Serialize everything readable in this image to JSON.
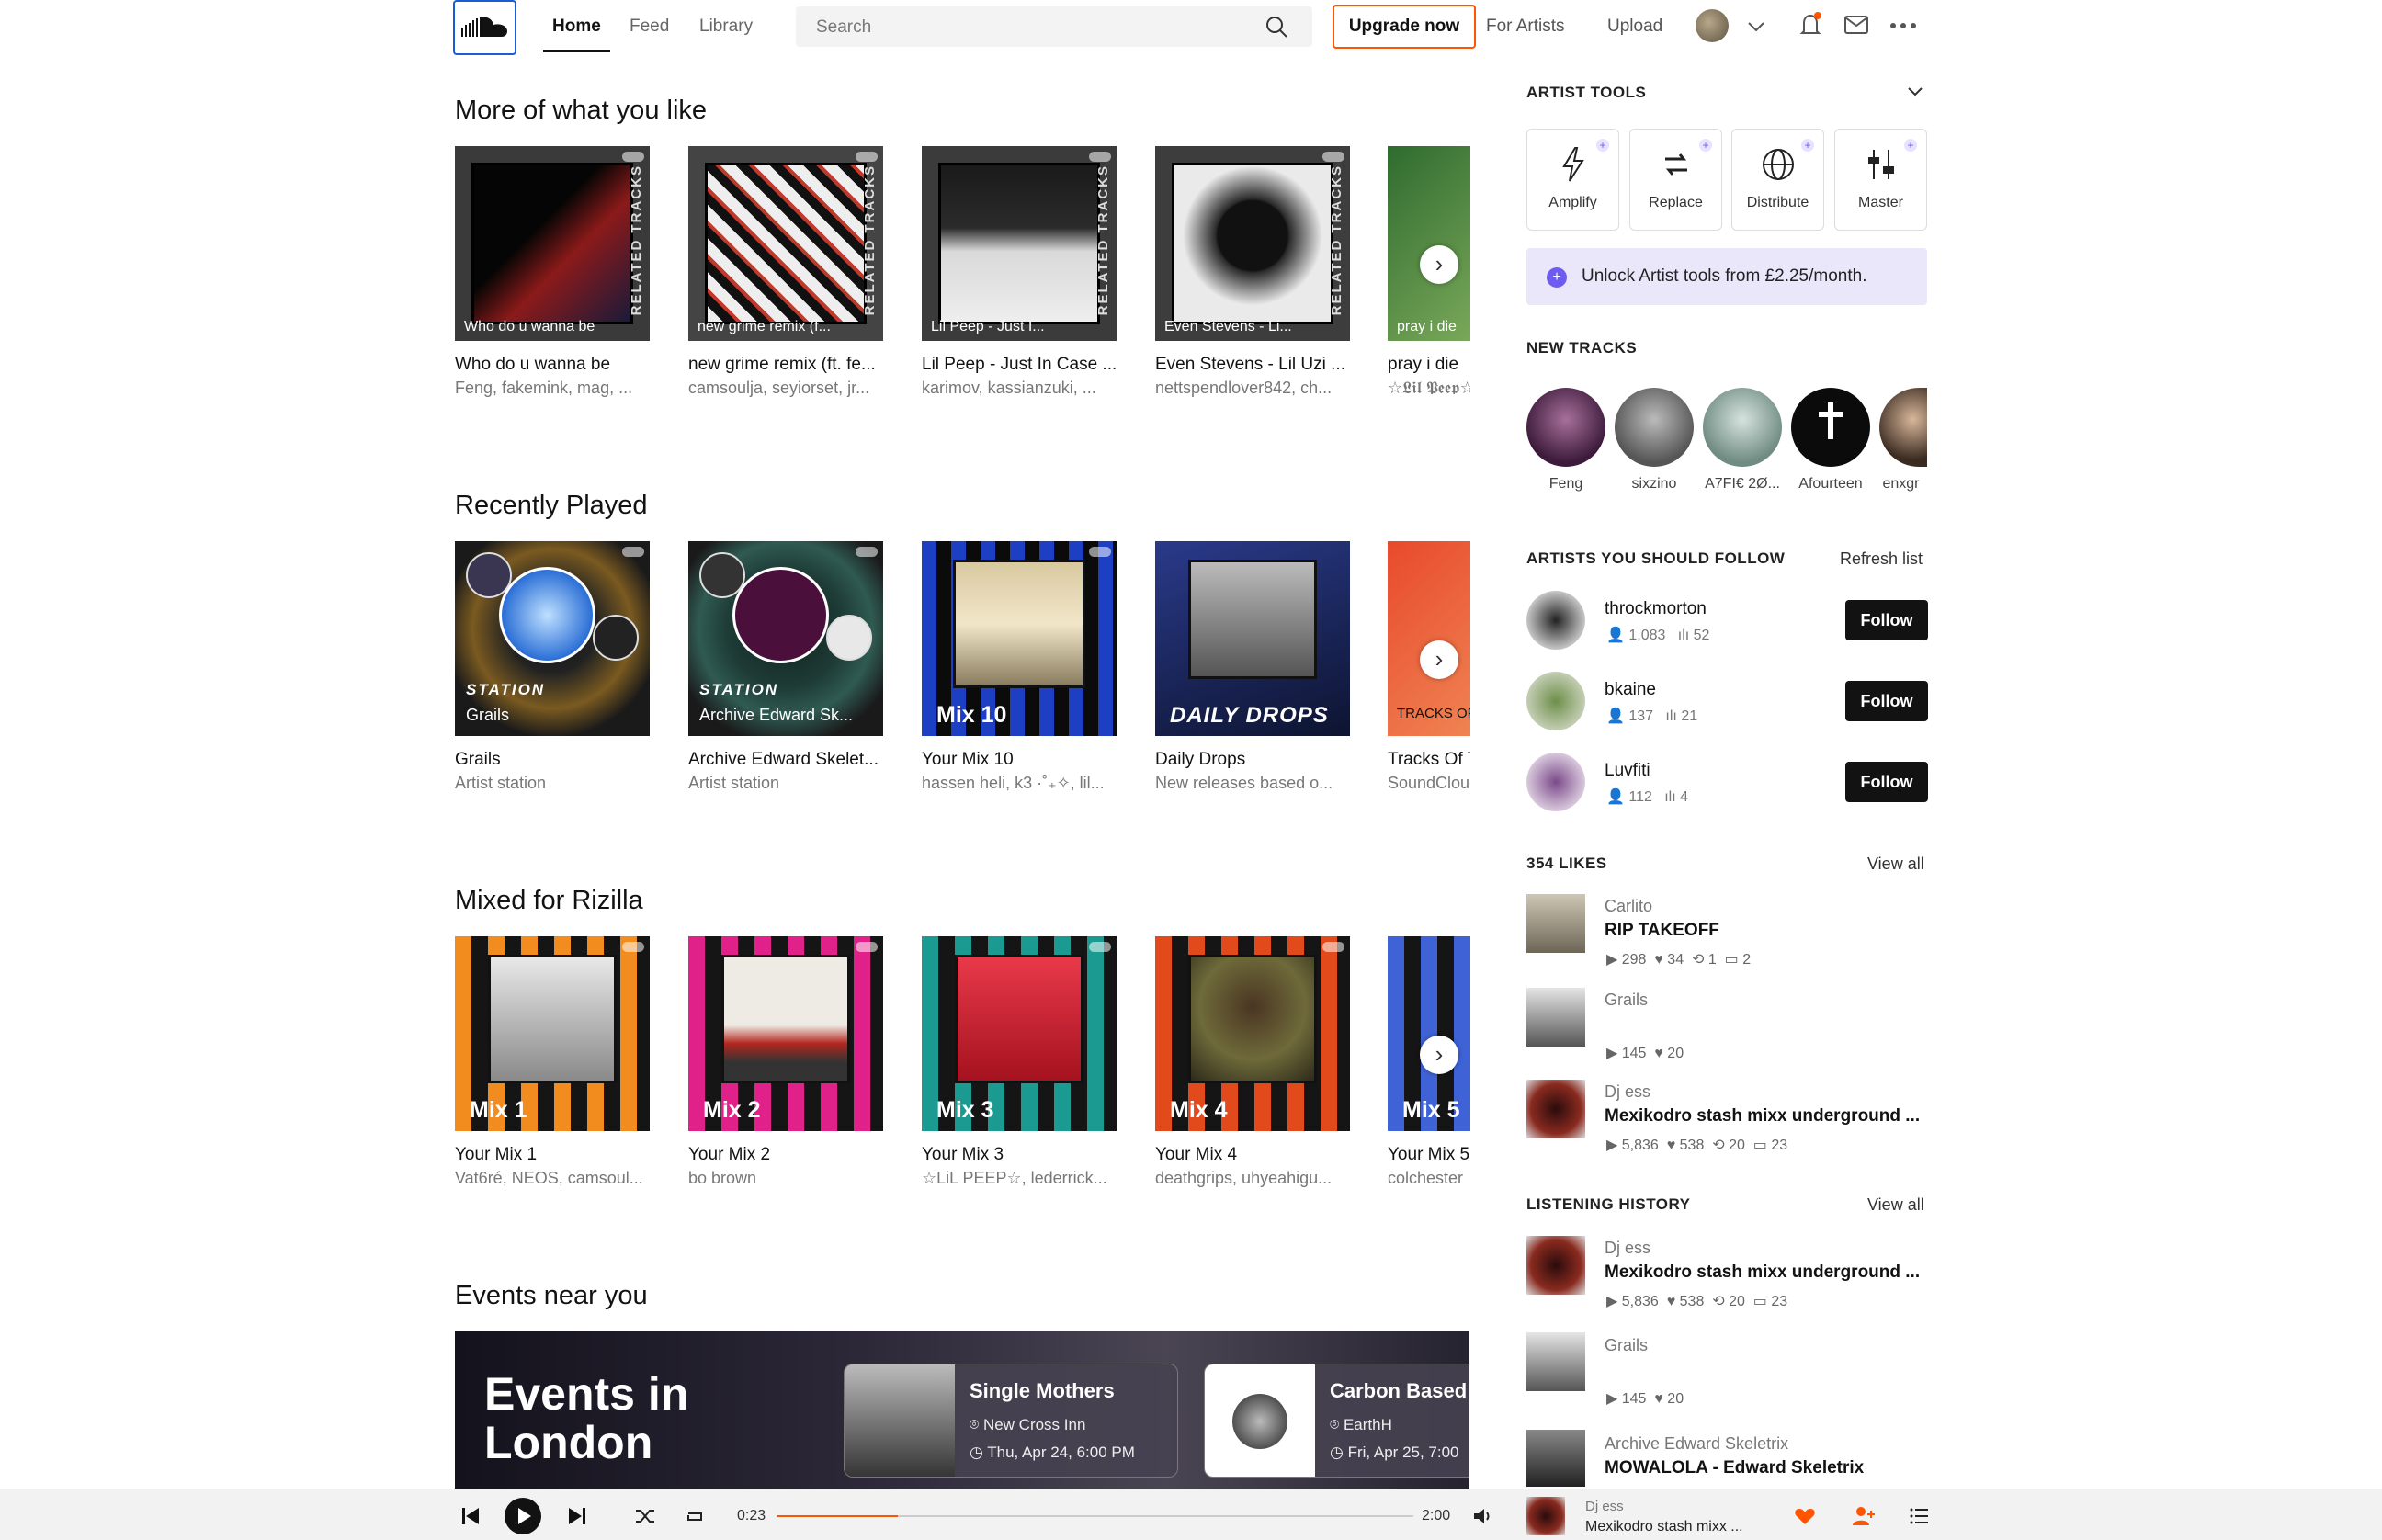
{
  "nav": {
    "tabs": [
      "Home",
      "Feed",
      "Library"
    ],
    "search_placeholder": "Search",
    "upgrade": "Upgrade now",
    "for_artists": "For Artists",
    "upload": "Upload"
  },
  "sections": {
    "more_like": "More of what you like",
    "recently_played": "Recently Played",
    "mixed_for": "Mixed for Rizilla",
    "events": "Events near you"
  },
  "more_like": [
    {
      "overlay": "Who do u wanna be",
      "title": "Who do u wanna be",
      "subtitle": "Feng, fakemink, mag, ...",
      "badge": "RELATED TRACKS"
    },
    {
      "overlay": "new grime remix (f...",
      "title": "new grime remix (ft. fe...",
      "subtitle": "camsoulja, seyiorset, jr...",
      "badge": "RELATED TRACKS"
    },
    {
      "overlay": "Lil Peep - Just I...",
      "title": "Lil Peep - Just In Case ...",
      "subtitle": "karimov, kassianzuki, ...",
      "badge": "RELATED TRACKS"
    },
    {
      "overlay": "Even Stevens - Li...",
      "title": "Even Stevens - Lil Uzi ...",
      "subtitle": "nettspendlover842, ch...",
      "badge": "RELATED TRACKS"
    },
    {
      "overlay": "pray i die",
      "title": "pray i die",
      "subtitle": "☆𝕷𝖎𝖑 𝕻𝖊𝖊𝖕☆"
    }
  ],
  "recently_played": [
    {
      "station_label": "STATION",
      "overlay": "Grails",
      "title": "Grails",
      "subtitle": "Artist station"
    },
    {
      "station_label": "STATION",
      "overlay": "Archive Edward Sk...",
      "title": "Archive Edward Skelet...",
      "subtitle": "Artist station"
    },
    {
      "overlay": "Mix 10",
      "title": "Your Mix 10",
      "subtitle": "hassen heli, k3 ·˚₊✧, lil..."
    },
    {
      "overlay": "DAILY DROPS",
      "title": "Daily Drops",
      "subtitle": "New releases based o..."
    },
    {
      "overlay": "TRACKS OF",
      "title": "Tracks Of The Week",
      "subtitle": "SoundCloud"
    }
  ],
  "mixed_for": [
    {
      "overlay": "Mix 1",
      "title": "Your Mix 1",
      "subtitle": "Vat6ré, NEOS, camsoul..."
    },
    {
      "overlay": "Mix 2",
      "title": "Your Mix 2",
      "subtitle": "bo brown"
    },
    {
      "overlay": "Mix 3",
      "title": "Your Mix 3",
      "subtitle": "☆LiL PEEP☆, lederrick..."
    },
    {
      "overlay": "Mix 4",
      "title": "Your Mix 4",
      "subtitle": "deathgrips, uhyeahigu..."
    },
    {
      "overlay": "Mix 5",
      "title": "Your Mix 5",
      "subtitle": "colchester"
    }
  ],
  "events": {
    "heading_line1": "Events in",
    "heading_line2": "London",
    "cards": [
      {
        "name": "Single Mothers",
        "venue": "New Cross Inn",
        "date": "Thu, Apr 24, 6:00 PM"
      },
      {
        "name": "Carbon Based",
        "venue": "EarthH",
        "date": "Fri, Apr 25, 7:00"
      }
    ]
  },
  "sidebar": {
    "artist_tools": {
      "title": "ARTIST TOOLS",
      "tools": [
        "Amplify",
        "Replace",
        "Distribute",
        "Master"
      ],
      "unlock": "Unlock Artist tools from £2.25/month."
    },
    "new_tracks": {
      "title": "NEW TRACKS",
      "artists": [
        "Feng",
        "sixzino",
        "A7FI€ 2Ø...",
        "Afourteen",
        "enxgr"
      ]
    },
    "follow": {
      "title": "ARTISTS YOU SHOULD FOLLOW",
      "refresh": "Refresh list",
      "button": "Follow",
      "artists": [
        {
          "name": "throckmorton",
          "followers": "1,083",
          "tracks": "52"
        },
        {
          "name": "bkaine",
          "followers": "137",
          "tracks": "21"
        },
        {
          "name": "Luvfiti",
          "followers": "112",
          "tracks": "4"
        }
      ]
    },
    "likes": {
      "title": "354 LIKES",
      "view_all": "View all",
      "items": [
        {
          "artist": "Carlito",
          "title": "RIP TAKEOFF",
          "plays": "298",
          "likes": "34",
          "reposts": "1",
          "comments": "2"
        },
        {
          "artist": "Grails",
          "title": "",
          "plays": "145",
          "likes": "20"
        },
        {
          "artist": "Dj ess",
          "title": "Mexikodro stash mixx underground ...",
          "plays": "5,836",
          "likes": "538",
          "reposts": "20",
          "comments": "23"
        }
      ]
    },
    "history": {
      "title": "LISTENING HISTORY",
      "view_all": "View all",
      "items": [
        {
          "artist": "Dj ess",
          "title": "Mexikodro stash mixx underground ...",
          "plays": "5,836",
          "likes": "538",
          "reposts": "20",
          "comments": "23"
        },
        {
          "artist": "Grails",
          "title": "",
          "plays": "145",
          "likes": "20"
        },
        {
          "artist": "Archive Edward Skeletrix",
          "title": "MOWALOLA - Edward Skeletrix"
        }
      ]
    }
  },
  "player": {
    "elapsed": "0:23",
    "duration": "2:00",
    "progress": 0.19,
    "artist": "Dj ess",
    "track": "Mexikodro stash mixx ..."
  },
  "colors": {
    "accent": "#ff5500",
    "purple": "#6e5cf0"
  }
}
